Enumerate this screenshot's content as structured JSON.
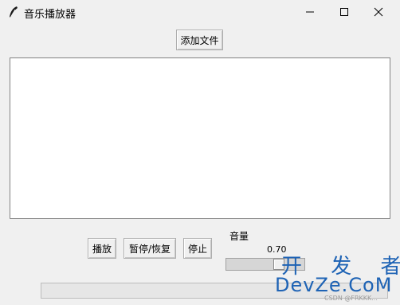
{
  "window": {
    "title": "音乐播放器",
    "controls": {
      "minimize": "minimize-icon",
      "maximize": "maximize-icon",
      "close": "close-icon"
    }
  },
  "toolbar": {
    "add_file_label": "添加文件"
  },
  "playlist": {
    "items": []
  },
  "controls": {
    "play_label": "播放",
    "pause_resume_label": "暂停/恢复",
    "stop_label": "停止"
  },
  "volume": {
    "label": "音量",
    "value_text": "0.70",
    "value": 0.7
  },
  "progress": {
    "value": 0
  },
  "watermark": {
    "line1": "开 发 者",
    "line2": "DevZe.CoM",
    "small": "CSDN @FRKKK..."
  },
  "colors": {
    "window_bg": "#f0f0f0",
    "list_bg": "#ffffff",
    "watermark": "#1e63b5"
  }
}
